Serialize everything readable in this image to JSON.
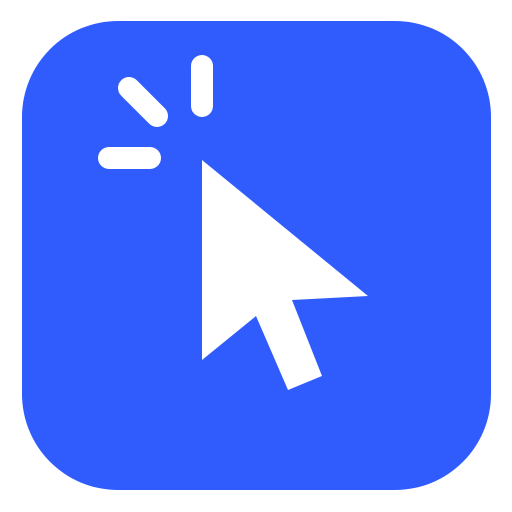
{
  "app_icon": {
    "icon": "cursor-click-icon",
    "tile_color": "#305CFE",
    "glyph_color": "#FFFFFF",
    "background_color": "#FFFFFF",
    "parts": [
      "rounded-square-tile",
      "arrow-cursor",
      "click-burst-lines"
    ]
  }
}
